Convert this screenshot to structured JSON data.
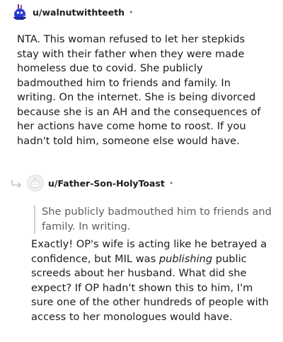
{
  "comment1": {
    "username": "u/walnutwithteeth",
    "avatar": "snoo-avatar-blue",
    "separator": "•",
    "body": "NTA. This woman refused to let her stepkids stay with their father when they were made homeless due to covid. She publicly badmouthed him to friends and family. In writing. On the internet. She is being divorced because she is an AH and the consequences of her actions have come home to roost. If you hadn't told him, someone else would have."
  },
  "comment2": {
    "reply_icon": "reply-arrow-icon",
    "username": "u/Father-Son-HolyToast",
    "avatar": "default-gray-avatar",
    "separator": "•",
    "quote": "She publicly badmouthed him to friends and family. In writing.",
    "body_before": "Exactly! OP's wife is acting like he betrayed a confidence, but MIL was ",
    "body_emphasis": "publishing",
    "body_after": " public screeds about her husband. What did she expect? If OP hadn't shown this to him, I'm sure one of the other hundreds of people with access to her monologues would have."
  },
  "colors": {
    "text": "#1c1c1c",
    "meta": "#7c7c7c",
    "quote_text": "#5f5f5f",
    "quote_bar": "#cfcfcf",
    "avatar_blue": "#2a3bd4"
  }
}
